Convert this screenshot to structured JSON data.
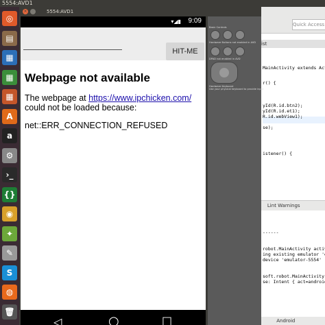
{
  "system": {
    "topbar_title": "5554:AVD1"
  },
  "launcher": {
    "items": [
      {
        "name": "ubuntu-dash-icon",
        "glyph": "◎",
        "color": "#e05a2a"
      },
      {
        "name": "files-icon",
        "glyph": "▤",
        "color": "#8a6a4a"
      },
      {
        "name": "writer-icon",
        "glyph": "▦",
        "color": "#2c6fb7"
      },
      {
        "name": "calc-icon",
        "glyph": "▦",
        "color": "#3b8e3b"
      },
      {
        "name": "impress-icon",
        "glyph": "▦",
        "color": "#c4562a"
      },
      {
        "name": "software-center-icon",
        "glyph": "A",
        "color": "#e06a1a"
      },
      {
        "name": "amazon-icon",
        "glyph": "a",
        "color": "#222"
      },
      {
        "name": "settings-icon",
        "glyph": "⚙",
        "color": "#888"
      },
      {
        "name": "terminal-icon",
        "glyph": "›_",
        "color": "#2a2a2a"
      },
      {
        "name": "brackets-icon",
        "glyph": "{}",
        "color": "#1e7d35"
      },
      {
        "name": "chrome-icon",
        "glyph": "◉",
        "color": "#d8a02a"
      },
      {
        "name": "android-icon",
        "glyph": "✦",
        "color": "#6ca83a"
      },
      {
        "name": "text-editor-icon",
        "glyph": "✎",
        "color": "#999"
      },
      {
        "name": "skype-icon",
        "glyph": "S",
        "color": "#1a8fd6"
      },
      {
        "name": "firefox-icon",
        "glyph": "◍",
        "color": "#e8691c"
      },
      {
        "name": "trash-icon",
        "glyph": "🗑",
        "color": "#555"
      }
    ]
  },
  "emulator": {
    "window_title": "5554:AVD1",
    "close_glyph": "×",
    "status_time": "9:09",
    "hit_button": "HIT-ME",
    "error_title": "Webpage not available",
    "error_prefix": "The webpage at ",
    "error_url": "https://www.ipchicken.com/",
    "error_suffix": " could not be loaded because:",
    "error_code": "net::ERR_CONNECTION_REFUSED",
    "nav": {
      "back": "◁",
      "home": "○",
      "recents": "□"
    }
  },
  "controls": {
    "basic_controls": "Basic Controls",
    "hardware_buttons": "Hardware Buttons not enabled in AVD",
    "dpad_label": "DPAD not enabled in AVD",
    "keyboard_label": "Hardware Keyboard",
    "keyboard_hint": "Use your physical keyboard to provide input"
  },
  "ide": {
    "quick_access": "Quick Access",
    "tab": "ist",
    "code_lines": [
      {
        "text": "MainActivity extends Act"
      },
      {
        "text": "r() {"
      },
      {
        "text": "yId(R.id.btn2);"
      },
      {
        "text": "yId(R.id.et1);"
      },
      {
        "text": "R.id.webView1);"
      },
      {
        "text": "se);"
      },
      {
        "text": "istener() {"
      }
    ],
    "bottom_tabs": "Lint Warnings",
    "console_lines": [
      "------",
      "robot.MainActivity activit",
      "ing existing emulator 'e",
      "device 'emulator-5554'",
      "soft.robot.MainActivity",
      "se: Intent { act=android.i"
    ],
    "status": "Android"
  }
}
